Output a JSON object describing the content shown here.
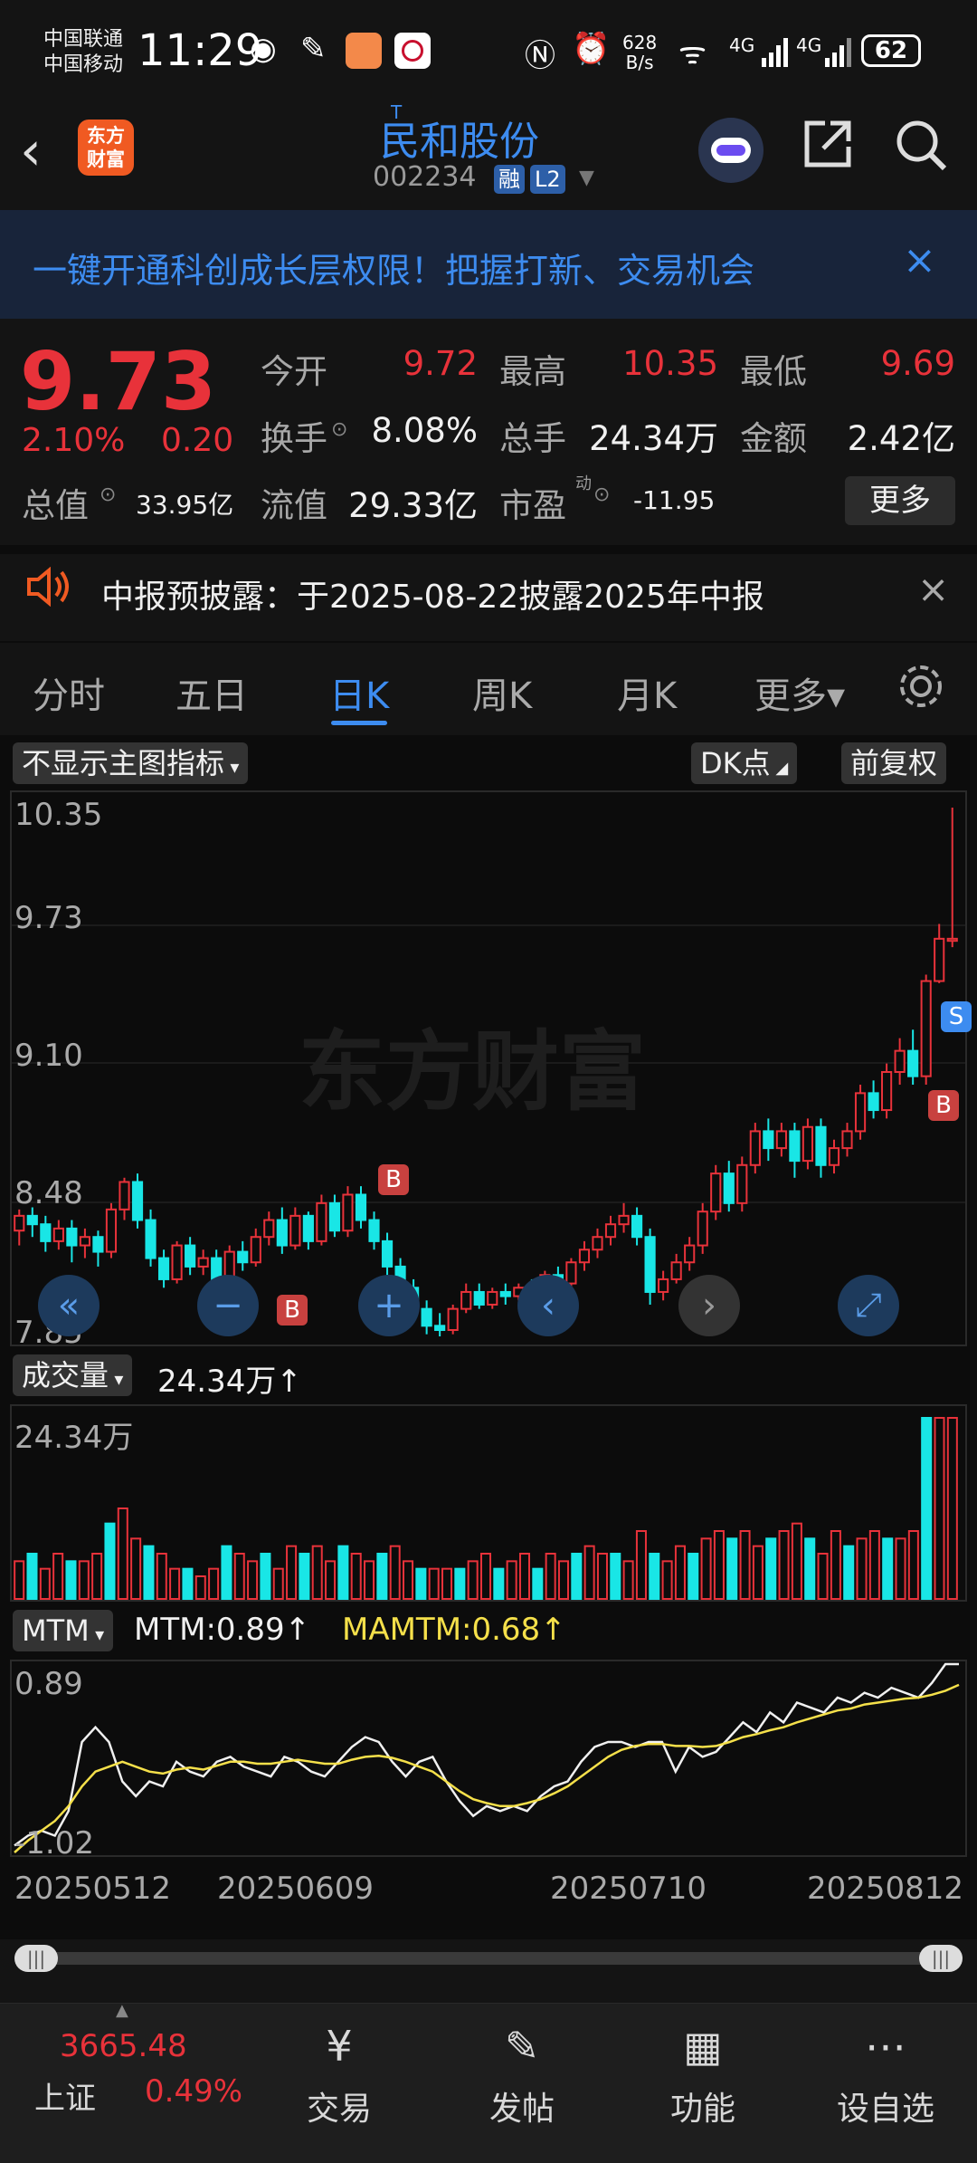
{
  "status_bar": {
    "carrier1": "中国联通",
    "carrier2": "中国移动",
    "time": "11:29",
    "speed_value": "628",
    "speed_unit": "B/s",
    "net1": "4G",
    "net2": "4G",
    "battery": "62"
  },
  "header": {
    "logo_line1": "东方",
    "logo_line2": "财富",
    "stock_sup": "T",
    "stock_name": "民和股份",
    "stock_code": "002234",
    "tag_margin": "融",
    "tag_level": "L2"
  },
  "banner": {
    "text": "一键开通科创成长层权限！把握打新、交易机会",
    "close": "×"
  },
  "quote": {
    "price": "9.73",
    "change_pct": "2.10%",
    "change_amt": "0.20",
    "open_label": "今开",
    "open_value": "9.72",
    "high_label": "最高",
    "high_value": "10.35",
    "low_label": "最低",
    "low_value": "9.69",
    "turnover_label": "换手",
    "turnover_value": "8.08%",
    "volume_label": "总手",
    "volume_value": "24.34万",
    "amount_label": "金额",
    "amount_value": "2.42亿",
    "mktcap_label": "总值",
    "mktcap_value": "33.95亿",
    "float_label": "流值",
    "float_value": "29.33亿",
    "pe_label": "市盈",
    "pe_sup": "动",
    "pe_value": "-11.95",
    "more_label": "更多"
  },
  "notice": {
    "text": "中报预披露：于2025-08-22披露2025年中报"
  },
  "tabs": {
    "items": [
      "分时",
      "五日",
      "日K",
      "周K",
      "月K",
      "更多▾"
    ],
    "active_index": 2
  },
  "chart_toolbar": {
    "indicator_select": "不显示主图指标",
    "dk_label": "DK点",
    "adjust_label": "前复权"
  },
  "watermark": "东方财富",
  "chart_data": [
    {
      "type": "candlestick",
      "price_labels": [
        "10.35",
        "9.73",
        "9.10",
        "8.48",
        "7.85"
      ],
      "ylim": [
        7.85,
        10.35
      ],
      "markers": [
        "B",
        "B",
        "B",
        "S"
      ],
      "candles": [
        [
          8.35,
          8.42,
          8.28,
          8.45
        ],
        [
          8.42,
          8.38,
          8.32,
          8.46
        ],
        [
          8.38,
          8.3,
          8.25,
          8.42
        ],
        [
          8.3,
          8.36,
          8.26,
          8.4
        ],
        [
          8.36,
          8.28,
          8.2,
          8.4
        ],
        [
          8.28,
          8.32,
          8.22,
          8.36
        ],
        [
          8.32,
          8.25,
          8.18,
          8.35
        ],
        [
          8.25,
          8.45,
          8.22,
          8.48
        ],
        [
          8.45,
          8.58,
          8.4,
          8.6
        ],
        [
          8.58,
          8.4,
          8.36,
          8.62
        ],
        [
          8.4,
          8.22,
          8.18,
          8.45
        ],
        [
          8.22,
          8.12,
          8.08,
          8.26
        ],
        [
          8.12,
          8.28,
          8.1,
          8.3
        ],
        [
          8.28,
          8.18,
          8.14,
          8.32
        ],
        [
          8.18,
          8.22,
          8.14,
          8.26
        ],
        [
          8.22,
          8.12,
          8.1,
          8.26
        ],
        [
          8.12,
          8.25,
          8.1,
          8.28
        ],
        [
          8.25,
          8.2,
          8.16,
          8.3
        ],
        [
          8.2,
          8.32,
          8.18,
          8.36
        ],
        [
          8.32,
          8.4,
          8.28,
          8.44
        ],
        [
          8.4,
          8.28,
          8.24,
          8.46
        ],
        [
          8.28,
          8.42,
          8.26,
          8.46
        ],
        [
          8.42,
          8.3,
          8.26,
          8.44
        ],
        [
          8.3,
          8.48,
          8.28,
          8.52
        ],
        [
          8.48,
          8.35,
          8.32,
          8.52
        ],
        [
          8.35,
          8.52,
          8.32,
          8.56
        ],
        [
          8.52,
          8.4,
          8.36,
          8.56
        ],
        [
          8.4,
          8.3,
          8.26,
          8.44
        ],
        [
          8.3,
          8.18,
          8.14,
          8.34
        ],
        [
          8.18,
          8.08,
          8.02,
          8.22
        ],
        [
          8.08,
          7.98,
          7.94,
          8.12
        ],
        [
          7.98,
          7.9,
          7.86,
          8.02
        ],
        [
          7.9,
          7.88,
          7.85,
          7.96
        ],
        [
          7.88,
          7.98,
          7.86,
          8.0
        ],
        [
          7.98,
          8.06,
          7.96,
          8.1
        ],
        [
          8.06,
          8.0,
          7.98,
          8.1
        ],
        [
          8.0,
          8.06,
          7.98,
          8.08
        ],
        [
          8.06,
          8.04,
          8.0,
          8.1
        ],
        [
          8.04,
          8.08,
          8.02,
          8.1
        ],
        [
          8.08,
          8.06,
          8.02,
          8.12
        ],
        [
          8.06,
          8.14,
          8.04,
          8.16
        ],
        [
          8.14,
          8.1,
          8.06,
          8.18
        ],
        [
          8.1,
          8.2,
          8.08,
          8.22
        ],
        [
          8.2,
          8.26,
          8.16,
          8.3
        ],
        [
          8.26,
          8.32,
          8.22,
          8.36
        ],
        [
          8.32,
          8.38,
          8.28,
          8.42
        ],
        [
          8.38,
          8.42,
          8.34,
          8.48
        ],
        [
          8.42,
          8.32,
          8.28,
          8.46
        ],
        [
          8.32,
          8.06,
          8.0,
          8.36
        ],
        [
          8.06,
          8.12,
          8.02,
          8.16
        ],
        [
          8.12,
          8.2,
          8.1,
          8.24
        ],
        [
          8.2,
          8.28,
          8.16,
          8.32
        ],
        [
          8.28,
          8.44,
          8.24,
          8.48
        ],
        [
          8.44,
          8.62,
          8.4,
          8.66
        ],
        [
          8.62,
          8.48,
          8.44,
          8.68
        ],
        [
          8.48,
          8.66,
          8.44,
          8.7
        ],
        [
          8.66,
          8.82,
          8.62,
          8.86
        ],
        [
          8.82,
          8.74,
          8.68,
          8.88
        ],
        [
          8.74,
          8.82,
          8.7,
          8.86
        ],
        [
          8.82,
          8.68,
          8.6,
          8.86
        ],
        [
          8.68,
          8.84,
          8.64,
          8.88
        ],
        [
          8.84,
          8.66,
          8.6,
          8.88
        ],
        [
          8.66,
          8.74,
          8.62,
          8.78
        ],
        [
          8.74,
          8.82,
          8.7,
          8.86
        ],
        [
          8.82,
          9.0,
          8.78,
          9.04
        ],
        [
          9.0,
          8.92,
          8.88,
          9.06
        ],
        [
          8.92,
          9.1,
          8.88,
          9.14
        ],
        [
          9.1,
          9.2,
          9.04,
          9.26
        ],
        [
          9.2,
          9.08,
          9.04,
          9.3
        ],
        [
          9.08,
          9.53,
          9.04,
          9.56
        ],
        [
          9.53,
          9.73,
          9.52,
          9.8
        ],
        [
          9.72,
          9.73,
          9.69,
          10.35
        ]
      ]
    },
    {
      "type": "bar",
      "label": "成交量",
      "value_label": "24.34万",
      "max_label": "24.34万",
      "values": [
        5,
        6,
        4,
        6,
        5,
        5,
        6,
        10,
        12,
        8,
        7,
        6,
        4,
        4,
        3,
        4,
        7,
        6,
        5,
        6,
        4,
        7,
        6,
        7,
        5,
        7,
        6,
        5,
        6,
        7,
        5,
        4,
        4,
        4,
        4,
        5,
        6,
        4,
        5,
        6,
        4,
        6,
        5,
        6,
        7,
        6,
        6,
        5,
        9,
        6,
        5,
        7,
        6,
        8,
        9,
        8,
        9,
        7,
        8,
        9,
        10,
        8,
        6,
        9,
        7,
        8,
        9,
        8,
        8,
        9,
        24,
        24,
        24
      ]
    },
    {
      "type": "line",
      "label": "MTM",
      "mtm_label": "MTM:0.89",
      "mamtm_label": "MAMTM:0.68",
      "max_label": "0.89",
      "min_label": "-1.02",
      "ylim": [
        -1.02,
        0.89
      ],
      "x_labels": [
        "20250512",
        "20250609",
        "20250710",
        "20250812"
      ],
      "series": [
        {
          "name": "MTM",
          "values": [
            -0.95,
            -0.85,
            -0.8,
            -0.85,
            -0.6,
            0.1,
            0.25,
            0.1,
            -0.3,
            -0.45,
            -0.3,
            -0.35,
            -0.1,
            -0.2,
            -0.25,
            -0.1,
            -0.05,
            -0.15,
            -0.2,
            -0.25,
            -0.05,
            -0.1,
            -0.2,
            -0.25,
            -0.1,
            0.05,
            0.15,
            0.1,
            -0.1,
            -0.25,
            -0.1,
            -0.05,
            -0.3,
            -0.5,
            -0.65,
            -0.55,
            -0.6,
            -0.55,
            -0.6,
            -0.45,
            -0.35,
            -0.3,
            -0.1,
            0.05,
            0.1,
            0.1,
            0.05,
            0.1,
            0.1,
            -0.2,
            0.05,
            -0.05,
            0.0,
            0.15,
            0.3,
            0.2,
            0.4,
            0.3,
            0.5,
            0.45,
            0.4,
            0.55,
            0.5,
            0.6,
            0.55,
            0.65,
            0.6,
            0.55,
            0.7,
            0.89,
            0.89
          ]
        },
        {
          "name": "MAMTM",
          "values": [
            -1.02,
            -0.9,
            -0.8,
            -0.7,
            -0.55,
            -0.35,
            -0.2,
            -0.15,
            -0.1,
            -0.15,
            -0.2,
            -0.22,
            -0.18,
            -0.16,
            -0.18,
            -0.14,
            -0.1,
            -0.1,
            -0.12,
            -0.12,
            -0.1,
            -0.08,
            -0.1,
            -0.12,
            -0.12,
            -0.08,
            -0.05,
            -0.04,
            -0.06,
            -0.1,
            -0.15,
            -0.2,
            -0.3,
            -0.4,
            -0.48,
            -0.52,
            -0.55,
            -0.55,
            -0.52,
            -0.48,
            -0.42,
            -0.35,
            -0.25,
            -0.15,
            -0.05,
            0.02,
            0.06,
            0.08,
            0.08,
            0.06,
            0.06,
            0.05,
            0.06,
            0.1,
            0.15,
            0.18,
            0.22,
            0.25,
            0.3,
            0.34,
            0.38,
            0.42,
            0.44,
            0.48,
            0.5,
            0.52,
            0.54,
            0.55,
            0.58,
            0.62,
            0.68
          ]
        }
      ]
    }
  ],
  "volume_toolbar": {
    "label": "成交量",
    "value": "24.34万↑"
  },
  "mtm_toolbar": {
    "label": "MTM",
    "mtm": "MTM:0.89↑",
    "mamtm": "MAMTM:0.68↑"
  },
  "bottom_nav": {
    "index_value": "3665.48",
    "index_name": "上证",
    "index_change": "0.49%",
    "items": [
      "交易",
      "发帖",
      "功能",
      "设自选"
    ]
  },
  "colors": {
    "up": "#e8323a",
    "down": "#19e6e6",
    "accent": "#3d8cf0",
    "mamtm": "#f5e04a",
    "mtm": "#f0f0f0"
  }
}
